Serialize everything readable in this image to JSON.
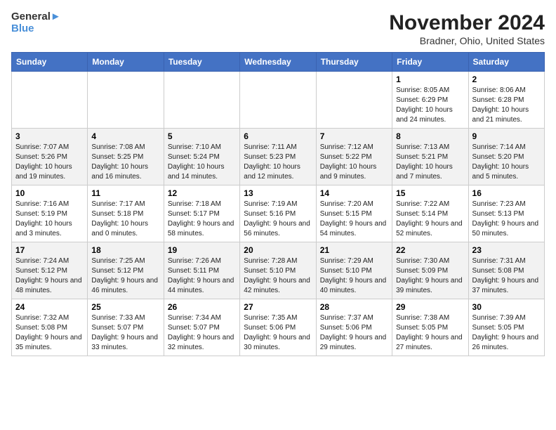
{
  "header": {
    "logo_line1": "General",
    "logo_line2": "Blue",
    "month_year": "November 2024",
    "location": "Bradner, Ohio, United States"
  },
  "days_of_week": [
    "Sunday",
    "Monday",
    "Tuesday",
    "Wednesday",
    "Thursday",
    "Friday",
    "Saturday"
  ],
  "weeks": [
    [
      {
        "day": "",
        "info": ""
      },
      {
        "day": "",
        "info": ""
      },
      {
        "day": "",
        "info": ""
      },
      {
        "day": "",
        "info": ""
      },
      {
        "day": "",
        "info": ""
      },
      {
        "day": "1",
        "info": "Sunrise: 8:05 AM\nSunset: 6:29 PM\nDaylight: 10 hours and 24 minutes."
      },
      {
        "day": "2",
        "info": "Sunrise: 8:06 AM\nSunset: 6:28 PM\nDaylight: 10 hours and 21 minutes."
      }
    ],
    [
      {
        "day": "3",
        "info": "Sunrise: 7:07 AM\nSunset: 5:26 PM\nDaylight: 10 hours and 19 minutes."
      },
      {
        "day": "4",
        "info": "Sunrise: 7:08 AM\nSunset: 5:25 PM\nDaylight: 10 hours and 16 minutes."
      },
      {
        "day": "5",
        "info": "Sunrise: 7:10 AM\nSunset: 5:24 PM\nDaylight: 10 hours and 14 minutes."
      },
      {
        "day": "6",
        "info": "Sunrise: 7:11 AM\nSunset: 5:23 PM\nDaylight: 10 hours and 12 minutes."
      },
      {
        "day": "7",
        "info": "Sunrise: 7:12 AM\nSunset: 5:22 PM\nDaylight: 10 hours and 9 minutes."
      },
      {
        "day": "8",
        "info": "Sunrise: 7:13 AM\nSunset: 5:21 PM\nDaylight: 10 hours and 7 minutes."
      },
      {
        "day": "9",
        "info": "Sunrise: 7:14 AM\nSunset: 5:20 PM\nDaylight: 10 hours and 5 minutes."
      }
    ],
    [
      {
        "day": "10",
        "info": "Sunrise: 7:16 AM\nSunset: 5:19 PM\nDaylight: 10 hours and 3 minutes."
      },
      {
        "day": "11",
        "info": "Sunrise: 7:17 AM\nSunset: 5:18 PM\nDaylight: 10 hours and 0 minutes."
      },
      {
        "day": "12",
        "info": "Sunrise: 7:18 AM\nSunset: 5:17 PM\nDaylight: 9 hours and 58 minutes."
      },
      {
        "day": "13",
        "info": "Sunrise: 7:19 AM\nSunset: 5:16 PM\nDaylight: 9 hours and 56 minutes."
      },
      {
        "day": "14",
        "info": "Sunrise: 7:20 AM\nSunset: 5:15 PM\nDaylight: 9 hours and 54 minutes."
      },
      {
        "day": "15",
        "info": "Sunrise: 7:22 AM\nSunset: 5:14 PM\nDaylight: 9 hours and 52 minutes."
      },
      {
        "day": "16",
        "info": "Sunrise: 7:23 AM\nSunset: 5:13 PM\nDaylight: 9 hours and 50 minutes."
      }
    ],
    [
      {
        "day": "17",
        "info": "Sunrise: 7:24 AM\nSunset: 5:12 PM\nDaylight: 9 hours and 48 minutes."
      },
      {
        "day": "18",
        "info": "Sunrise: 7:25 AM\nSunset: 5:12 PM\nDaylight: 9 hours and 46 minutes."
      },
      {
        "day": "19",
        "info": "Sunrise: 7:26 AM\nSunset: 5:11 PM\nDaylight: 9 hours and 44 minutes."
      },
      {
        "day": "20",
        "info": "Sunrise: 7:28 AM\nSunset: 5:10 PM\nDaylight: 9 hours and 42 minutes."
      },
      {
        "day": "21",
        "info": "Sunrise: 7:29 AM\nSunset: 5:10 PM\nDaylight: 9 hours and 40 minutes."
      },
      {
        "day": "22",
        "info": "Sunrise: 7:30 AM\nSunset: 5:09 PM\nDaylight: 9 hours and 39 minutes."
      },
      {
        "day": "23",
        "info": "Sunrise: 7:31 AM\nSunset: 5:08 PM\nDaylight: 9 hours and 37 minutes."
      }
    ],
    [
      {
        "day": "24",
        "info": "Sunrise: 7:32 AM\nSunset: 5:08 PM\nDaylight: 9 hours and 35 minutes."
      },
      {
        "day": "25",
        "info": "Sunrise: 7:33 AM\nSunset: 5:07 PM\nDaylight: 9 hours and 33 minutes."
      },
      {
        "day": "26",
        "info": "Sunrise: 7:34 AM\nSunset: 5:07 PM\nDaylight: 9 hours and 32 minutes."
      },
      {
        "day": "27",
        "info": "Sunrise: 7:35 AM\nSunset: 5:06 PM\nDaylight: 9 hours and 30 minutes."
      },
      {
        "day": "28",
        "info": "Sunrise: 7:37 AM\nSunset: 5:06 PM\nDaylight: 9 hours and 29 minutes."
      },
      {
        "day": "29",
        "info": "Sunrise: 7:38 AM\nSunset: 5:05 PM\nDaylight: 9 hours and 27 minutes."
      },
      {
        "day": "30",
        "info": "Sunrise: 7:39 AM\nSunset: 5:05 PM\nDaylight: 9 hours and 26 minutes."
      }
    ]
  ]
}
